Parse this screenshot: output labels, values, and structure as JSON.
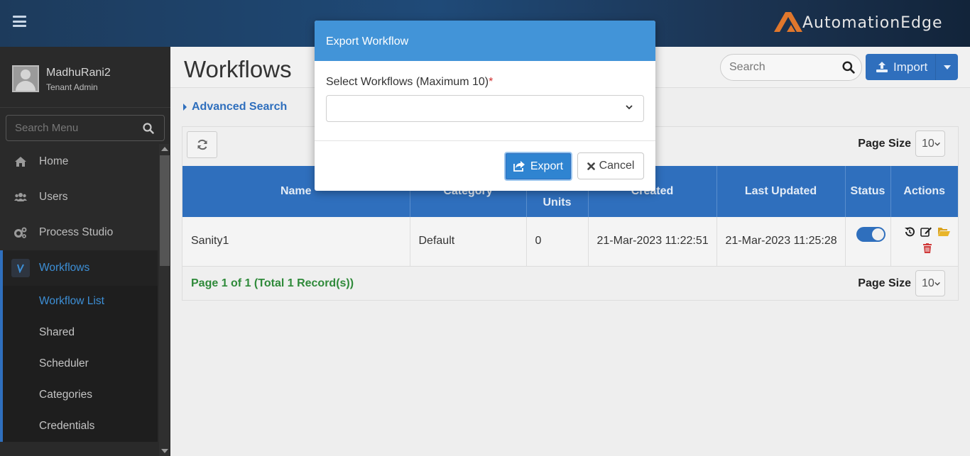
{
  "header": {
    "brand": "AutomationEdge",
    "brand_color": "#e0772c"
  },
  "sidebar": {
    "user_name": "MadhuRani2",
    "user_role": "Tenant Admin",
    "search_placeholder": "Search Menu",
    "items": [
      {
        "label": "Home",
        "icon": "home-icon"
      },
      {
        "label": "Users",
        "icon": "users-icon"
      },
      {
        "label": "Process Studio",
        "icon": "gears-icon"
      },
      {
        "label": "Workflows",
        "icon": "workflow-icon"
      }
    ],
    "sub_items": [
      {
        "label": "Workflow List"
      },
      {
        "label": "Shared"
      },
      {
        "label": "Scheduler"
      },
      {
        "label": "Categories"
      },
      {
        "label": "Credentials"
      }
    ]
  },
  "main": {
    "title": "Workflows",
    "search_placeholder": "Search",
    "import_label": "Import",
    "advanced_search": "Advanced Search",
    "page_size_label": "Page Size",
    "page_size_value": "10",
    "table": {
      "headers": [
        "Name",
        "Category",
        "Units",
        "Created",
        "Last Updated",
        "Status",
        "Actions"
      ],
      "rows": [
        {
          "name": "Sanity1",
          "category": "Default",
          "units": "0",
          "created": "21-Mar-2023 11:22:51",
          "updated": "21-Mar-2023 11:25:28",
          "status": "enabled"
        }
      ]
    },
    "page_info": "Page 1 of 1 (Total 1 Record(s))"
  },
  "modal": {
    "title": "Export Workflow",
    "field_label": "Select Workflows (Maximum 10)",
    "required_mark": "*",
    "export_label": "Export",
    "cancel_label": "Cancel"
  },
  "colors": {
    "primary": "#2f6fbd",
    "modal_header": "#4294d8",
    "success_text": "#2f8a3a"
  }
}
